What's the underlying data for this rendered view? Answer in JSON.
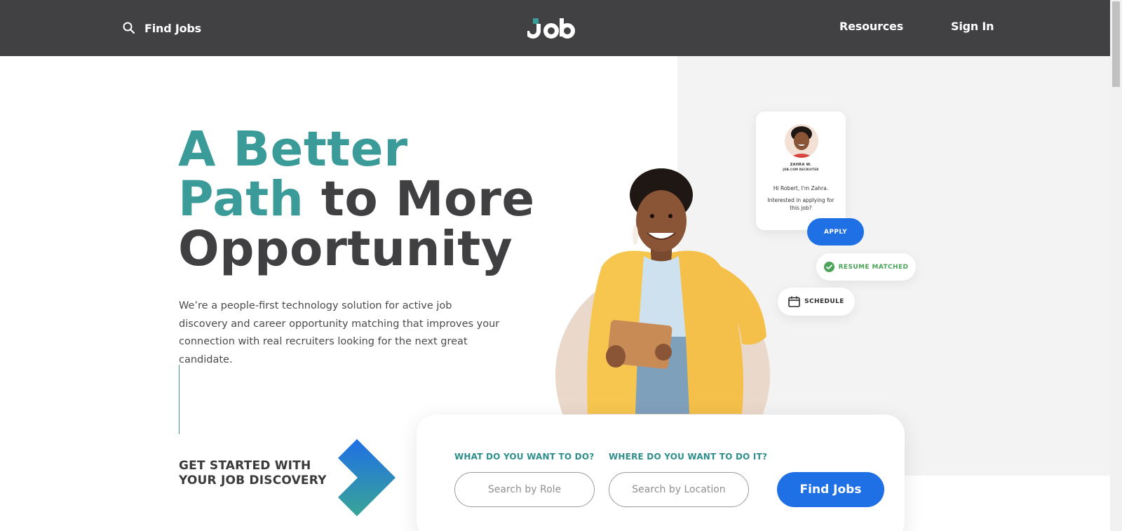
{
  "header": {
    "find_jobs_label": "Find Jobs",
    "logo_text": "Job",
    "resources_label": "Resources",
    "sign_in_label": "Sign In"
  },
  "hero": {
    "title_line1": "A Better",
    "title_line2_accent": "Path",
    "title_line2_rest": " to More",
    "title_line3": "Opportunity",
    "description": "We’re a people-first technology solution for active job discovery and career opportunity matching that improves your connection with real recruiters looking for the next great candidate.",
    "cta_line1": "GET STARTED WITH",
    "cta_line2": "YOUR JOB DISCOVERY"
  },
  "chat_card": {
    "recruiter_name": "ZAHRA W.",
    "recruiter_role": "JOB.COM RECRUITER",
    "greeting": "Hi Robert, I'm Zahra.",
    "question": "Interested in applying for this job?"
  },
  "badges": {
    "apply": "APPLY",
    "resume_matched": "RESUME MATCHED",
    "schedule": "SCHEDULE"
  },
  "search": {
    "role_label": "WHAT DO YOU WANT TO DO?",
    "role_placeholder": "Search by Role",
    "location_label": "WHERE DO YOU WANT TO DO IT?",
    "location_placeholder": "Search by Location",
    "button_label": "Find Jobs"
  },
  "colors": {
    "header_bg": "#414143",
    "accent_teal": "#3a9b98",
    "primary_blue": "#1f6fe5",
    "success_green": "#4ba357"
  },
  "icons": [
    "search-icon",
    "check-circle-icon",
    "calendar-icon",
    "chevron-arrow-icon"
  ]
}
